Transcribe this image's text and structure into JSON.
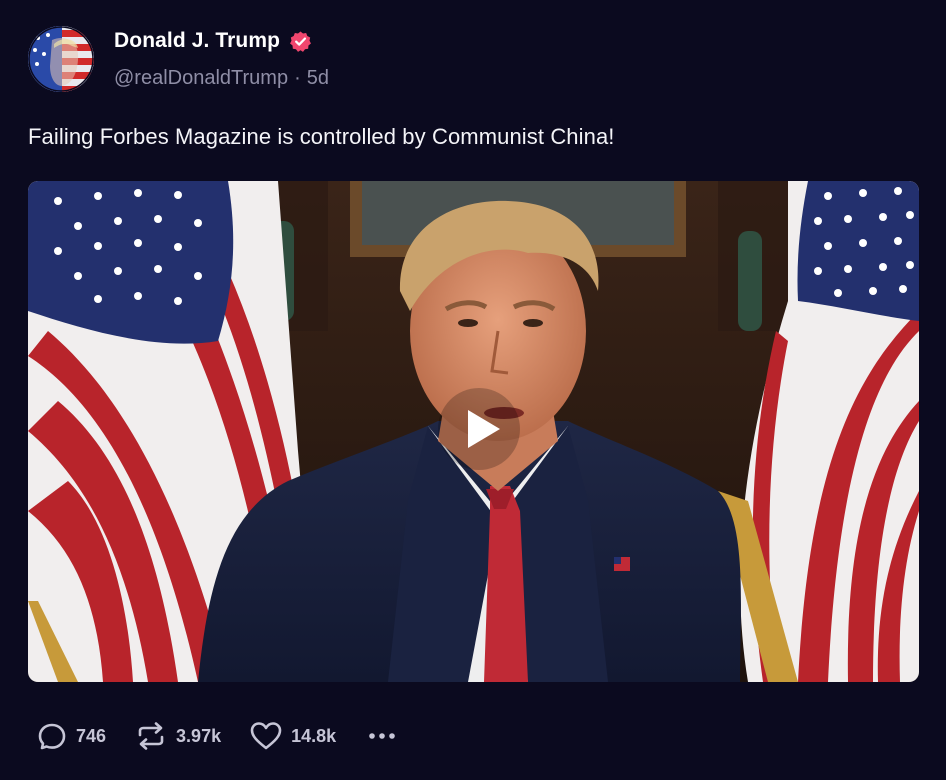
{
  "post": {
    "author": {
      "display_name": "Donald J. Trump",
      "handle": "@realDonaldTrump",
      "separator": "·",
      "age": "5d",
      "verified": true,
      "verified_color": "#f0466e",
      "avatar_icon": "flag-portrait-avatar"
    },
    "text": "Failing Forbes Magazine is controlled by Communist China!",
    "media": {
      "type": "video",
      "play_icon": "play-icon"
    },
    "actions": {
      "replies": {
        "icon": "reply-icon",
        "count": "746"
      },
      "reposts": {
        "icon": "repost-icon",
        "count": "3.97k"
      },
      "likes": {
        "icon": "heart-icon",
        "count": "14.8k"
      },
      "more": {
        "icon": "more-dots-icon"
      }
    }
  },
  "theme": {
    "background": "#0b0a1f",
    "secondary_text": "#8f8ea6",
    "action_text": "#c6c5d6"
  }
}
